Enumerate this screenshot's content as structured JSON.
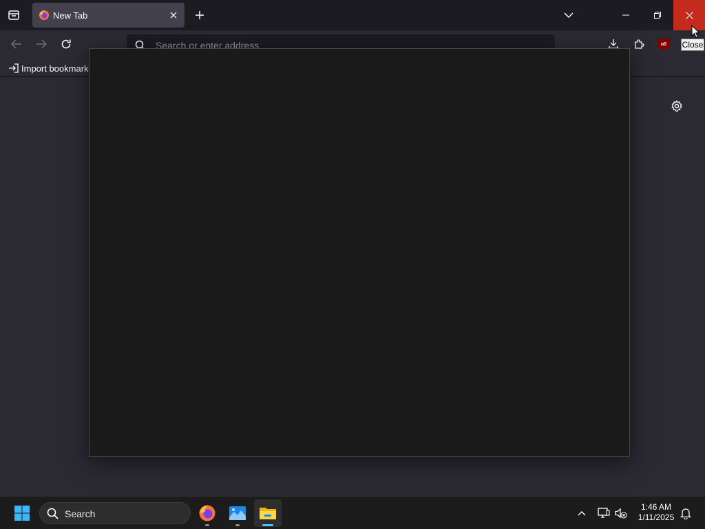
{
  "browser": {
    "tab": {
      "title": "New Tab"
    },
    "urlbar": {
      "placeholder": "Search or enter address"
    },
    "bookmarks": {
      "import_label": "Import bookmarks"
    },
    "extension_badge": "u0",
    "tooltip": "Close"
  },
  "taskbar": {
    "search_label": "Search",
    "clock": {
      "time": "1:46 AM",
      "date": "1/11/2025"
    }
  },
  "icons": [
    "firefox-view-icon",
    "firefox-favicon",
    "tab-close-icon",
    "new-tab-icon",
    "list-all-tabs-icon",
    "minimize-icon",
    "restore-icon",
    "close-icon",
    "back-icon",
    "forward-icon",
    "reload-icon",
    "search-icon",
    "downloads-icon",
    "extensions-icon",
    "ublock-origin-icon",
    "import-icon",
    "gear-icon",
    "cursor-icon",
    "windows-logo-icon",
    "firefox-icon",
    "photos-icon",
    "file-explorer-icon",
    "chevron-up-icon",
    "network-icon",
    "volume-muted-icon",
    "notification-bell-icon"
  ],
  "colors": {
    "tabbar_bg": "#1c1b22",
    "toolbar_bg": "#2b2a33",
    "active_tab_bg": "#42414d",
    "close_hover": "#c42b1c",
    "dialog_bg": "#1a1a1b",
    "taskbar_bg": "#1c1c1c",
    "accent": "#4cc2ff"
  }
}
